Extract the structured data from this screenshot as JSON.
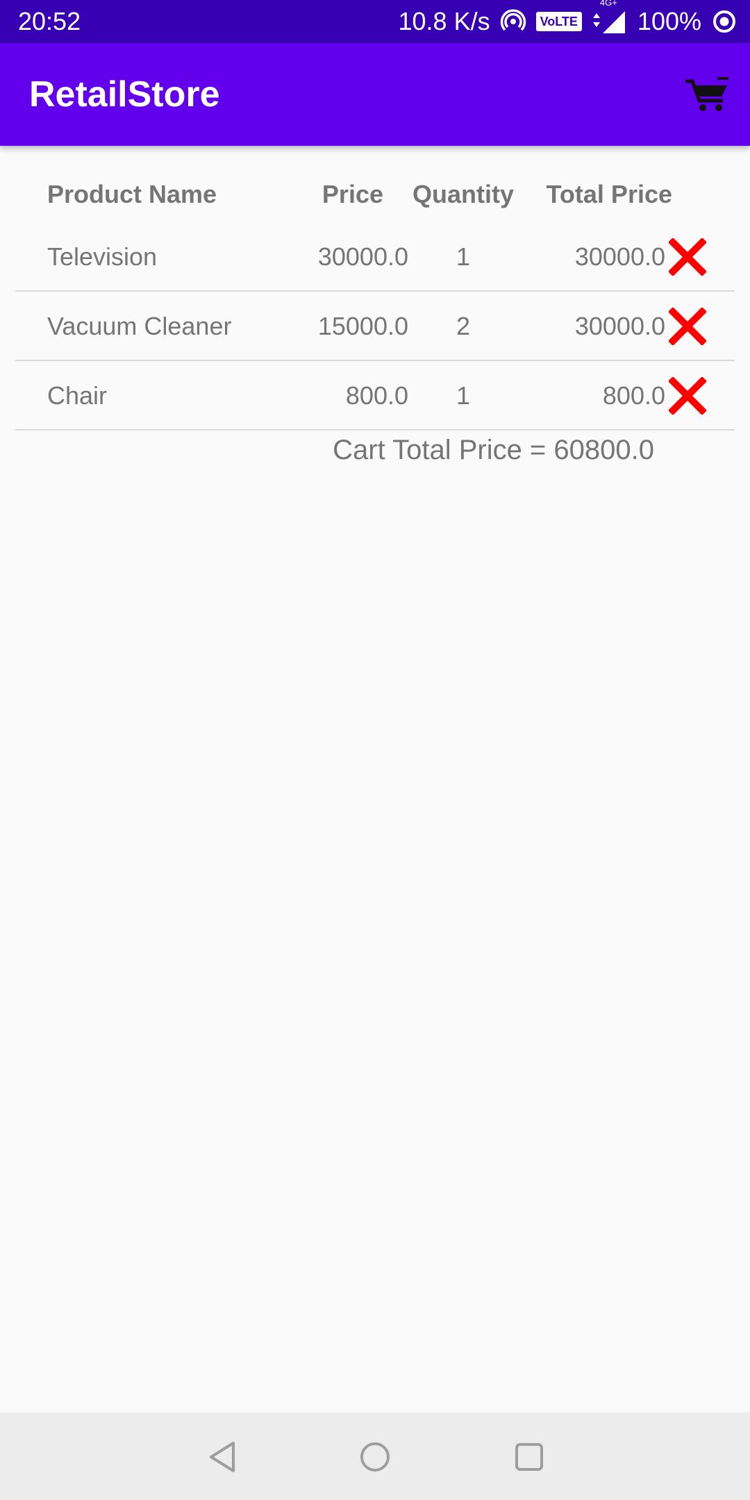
{
  "status_bar": {
    "time": "20:52",
    "network_speed": "10.8 K/s",
    "volte": "VoLTE",
    "network_type": "4G+",
    "battery": "100%",
    "icons": [
      "hotspot-icon",
      "signal-icon",
      "battery-ring-icon"
    ]
  },
  "app_bar": {
    "title": "RetailStore",
    "cart_icon": "cart-icon"
  },
  "table": {
    "headers": {
      "name": "Product Name",
      "price": "Price",
      "quantity": "Quantity",
      "total": "Total Price"
    },
    "rows": [
      {
        "name": "Television",
        "price": "30000.0",
        "quantity": "1",
        "total": "30000.0"
      },
      {
        "name": "Vacuum Cleaner",
        "price": "15000.0",
        "quantity": "2",
        "total": "30000.0"
      },
      {
        "name": "Chair",
        "price": "800.0",
        "quantity": "1",
        "total": "800.0"
      }
    ]
  },
  "cart_total": "Cart Total Price = 60800.0",
  "colors": {
    "status_bar": "#3700b3",
    "app_bar": "#6200ee",
    "delete": "#ff0000",
    "text": "#757575",
    "nav_bar": "#ececec"
  },
  "nav_bar": {
    "icons": [
      "back-icon",
      "home-icon",
      "recents-icon"
    ]
  }
}
